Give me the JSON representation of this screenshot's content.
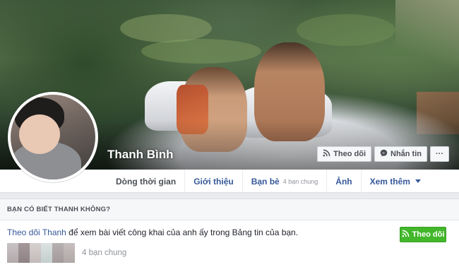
{
  "profile": {
    "name": "Thanh Bình"
  },
  "cover_actions": [
    {
      "label": "Theo dõi",
      "icon": "rss-icon"
    },
    {
      "label": "Nhắn tin",
      "icon": "messenger-icon"
    },
    {
      "label": "···",
      "icon": "more-icon"
    }
  ],
  "tabs": [
    {
      "label": "Dòng thời gian",
      "sub": ""
    },
    {
      "label": "Giới thiệu",
      "sub": ""
    },
    {
      "label": "Bạn bè",
      "sub": "4 bạn chung"
    },
    {
      "label": "Ảnh",
      "sub": ""
    },
    {
      "label": "Xem thêm",
      "sub": ""
    }
  ],
  "suggestion": {
    "heading": "BẠN CÓ BIẾT THANH KHÔNG?",
    "link": "Theo dõi Thanh",
    "text": " để xem bài viết công khai của anh ấy trong Bảng tin của bạn.",
    "button": "Theo dõi",
    "mutual": "4 bạn chung"
  },
  "colors": {
    "link": "#365899",
    "follow_green": "#42b72a"
  }
}
